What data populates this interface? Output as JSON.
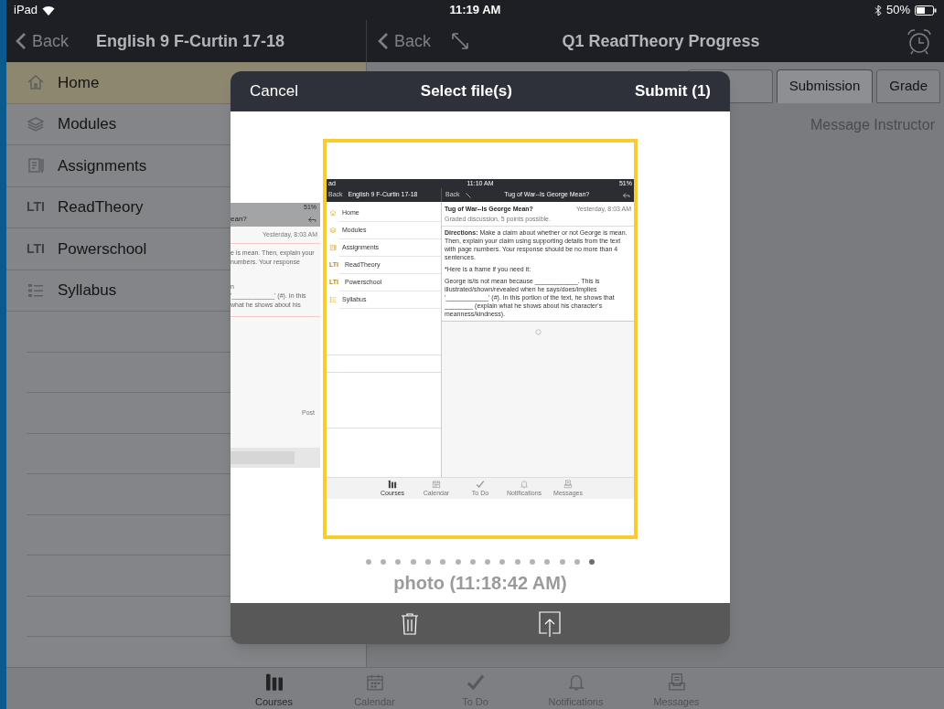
{
  "status_bar": {
    "carrier": "iPad",
    "time": "11:19 AM",
    "battery": "50%"
  },
  "left_nav": {
    "back": "Back",
    "title": "English 9 F-Curtin 17-18"
  },
  "right_nav": {
    "back": "Back",
    "title": "Q1 ReadTheory Progress"
  },
  "sidebar": {
    "items": [
      {
        "label": "Home",
        "kind": "home",
        "selected": true
      },
      {
        "label": "Modules",
        "kind": "modules",
        "selected": false
      },
      {
        "label": "Assignments",
        "kind": "assignments",
        "selected": false
      },
      {
        "label": "ReadTheory",
        "kind": "lti",
        "badge": "LTI",
        "selected": false
      },
      {
        "label": "Powerschool",
        "kind": "lti",
        "badge": "LTI",
        "selected": false
      },
      {
        "label": "Syllabus",
        "kind": "syllabus",
        "selected": false
      }
    ]
  },
  "tabs": [
    {
      "selected": false
    },
    {
      "label": "Submission",
      "selected": true
    },
    {
      "label": "Grade",
      "selected": false
    }
  ],
  "message_link": "Message Instructor",
  "tab_bar": [
    {
      "label": "Courses",
      "kind": "courses",
      "selected": true
    },
    {
      "label": "Calendar",
      "kind": "calendar",
      "selected": false
    },
    {
      "label": "To Do",
      "kind": "todo",
      "selected": false
    },
    {
      "label": "Notifications",
      "kind": "notifications",
      "selected": false
    },
    {
      "label": "Messages",
      "kind": "messages",
      "selected": false
    }
  ],
  "dialog": {
    "cancel": "Cancel",
    "title": "Select file(s)",
    "submit": "Submit (1)",
    "side_preview": {
      "battery": "51%",
      "title": "ean?",
      "date": "Yesterday, 8:03 AM",
      "lines": [
        "e is mean. Then, explain your",
        "numbers. Your response",
        "n",
        "'____________' (#). In this",
        "what he shows about his"
      ],
      "button": "Post"
    },
    "preview": {
      "carrier": "ad",
      "time": "11:10 AM",
      "battery": "51%",
      "left_back": "Back",
      "course": "English 9 F-Curtin 17-18",
      "right_back": "Back",
      "title": "Tug of War--Is George Mean?",
      "menu": [
        {
          "label": "Home",
          "kind": "home"
        },
        {
          "label": "Modules",
          "kind": "modules"
        },
        {
          "label": "Assignments",
          "kind": "assignments"
        },
        {
          "label": "ReadTheory",
          "kind": "lti",
          "badge": "LTI"
        },
        {
          "label": "Powerschool",
          "kind": "lti",
          "badge": "LTI"
        },
        {
          "label": "Syllabus",
          "kind": "syllabus"
        }
      ],
      "post_title": "Tug of War--Is George Mean?",
      "post_date": "Yesterday, 8:03 AM",
      "post_meta": "Graded discussion, 5 points possible.",
      "directions": "**Directions:** Make a claim about whether or not George is mean. Then, explain your claim using supporting details from the text with page numbers. Your response should be no more than 4 sentences.",
      "frame_note": "*Here is a frame if you need it:",
      "frame_text": "George is/is not mean because ____________. This is illustrated/shown/revealed when he says/does/implies '____________' (#). In this portion of the text, he shows that ________ (explain what he shows about his character's meanness/kindness).",
      "tabs": [
        {
          "label": "Courses",
          "kind": "courses"
        },
        {
          "label": "Calendar",
          "kind": "calendar"
        },
        {
          "label": "To Do",
          "kind": "todo"
        },
        {
          "label": "Notifications",
          "kind": "notifications"
        },
        {
          "label": "Messages",
          "kind": "messages"
        }
      ]
    },
    "pages": [
      {
        "selected": false
      },
      {
        "selected": false
      },
      {
        "selected": false
      },
      {
        "selected": false
      },
      {
        "selected": false
      },
      {
        "selected": false
      },
      {
        "selected": false
      },
      {
        "selected": false
      },
      {
        "selected": false
      },
      {
        "selected": false
      },
      {
        "selected": false
      },
      {
        "selected": false
      },
      {
        "selected": false
      },
      {
        "selected": false
      },
      {
        "selected": false
      },
      {
        "selected": true
      }
    ],
    "caption": "photo (11:18:42 AM)"
  }
}
